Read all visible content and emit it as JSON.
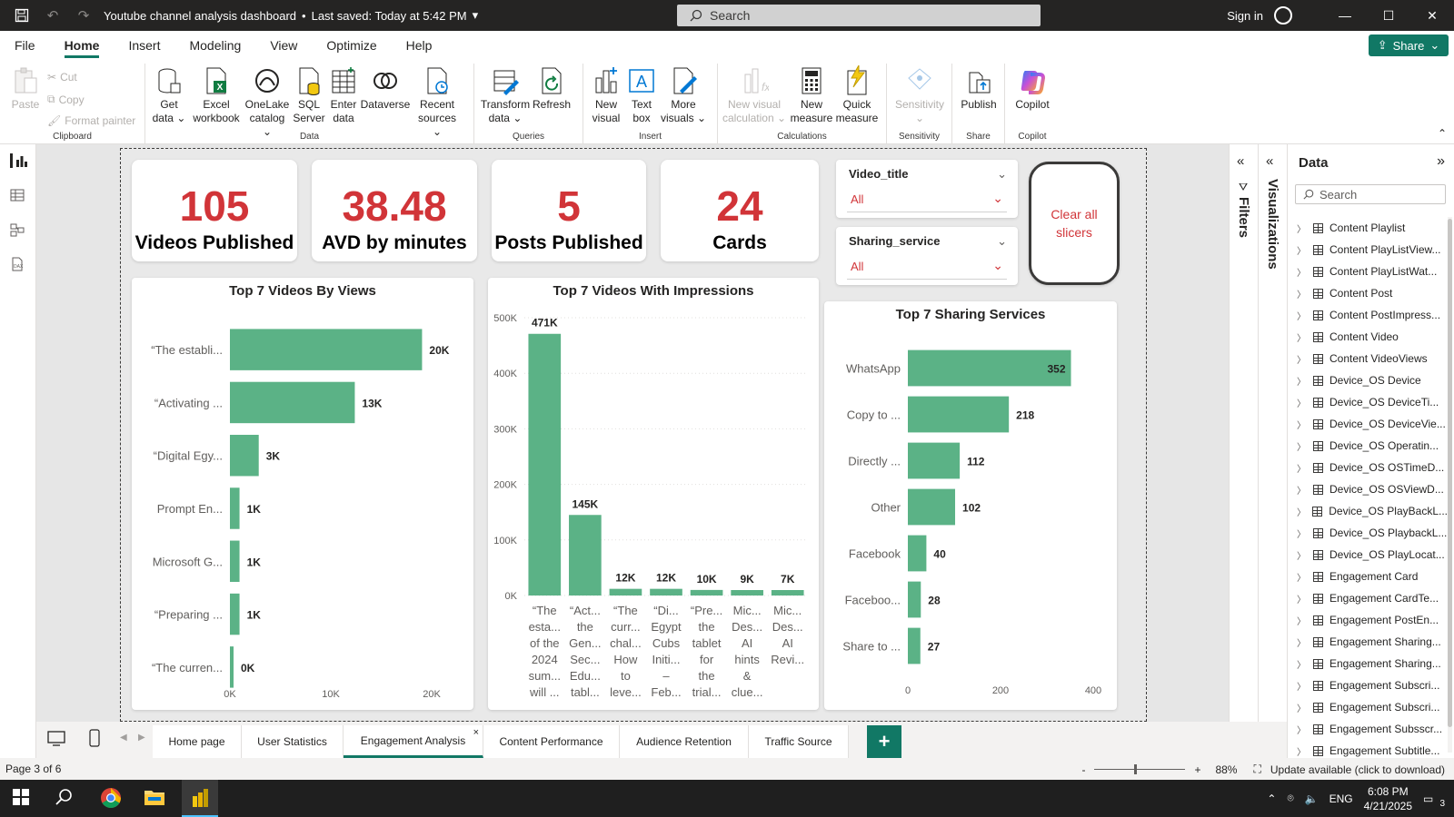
{
  "window": {
    "title": "Youtube channel analysis dashboard",
    "saved": "Last saved: Today at 5:42 PM",
    "search_placeholder": "Search",
    "sign_in": "Sign in"
  },
  "menu": {
    "items": [
      "File",
      "Home",
      "Insert",
      "Modeling",
      "View",
      "Optimize",
      "Help"
    ],
    "active": "Home",
    "share_label": "Share"
  },
  "ribbon": {
    "clipboard": {
      "label": "Clipboard",
      "paste": "Paste",
      "cut": "Cut",
      "copy": "Copy",
      "format_painter": "Format painter"
    },
    "data": {
      "label": "Data",
      "get_data": "Get data",
      "excel": "Excel workbook",
      "onelake": "OneLake catalog",
      "sql": "SQL Server",
      "enter": "Enter data",
      "dataverse": "Dataverse",
      "recent": "Recent sources"
    },
    "queries": {
      "label": "Queries",
      "transform": "Transform data",
      "refresh": "Refresh"
    },
    "insert": {
      "label": "Insert",
      "new_visual": "New visual",
      "text_box": "Text box",
      "more_visuals": "More visuals"
    },
    "calculations": {
      "label": "Calculations",
      "new_visual_calc": "New visual calculation",
      "new_measure": "New measure",
      "quick_measure": "Quick measure"
    },
    "sensitivity": {
      "label": "Sensitivity",
      "btn": "Sensitivity"
    },
    "share": {
      "label": "Share",
      "publish": "Publish"
    },
    "copilot": {
      "label": "Copilot",
      "btn": "Copilot"
    }
  },
  "kpis": [
    {
      "value": "105",
      "label": "Videos Published"
    },
    {
      "value": "38.48",
      "label": "AVD by minutes"
    },
    {
      "value": "5",
      "label": "Posts Published"
    },
    {
      "value": "24",
      "label": "Cards"
    }
  ],
  "slicers": [
    {
      "title": "Video_title",
      "value": "All"
    },
    {
      "title": "Sharing_service",
      "value": "All"
    }
  ],
  "clear_button": "Clear all slicers",
  "chart_data": [
    {
      "type": "bar",
      "orientation": "horizontal",
      "title": "Top 7 Videos By Views",
      "categories": [
        "“The establi...",
        "“Activating ...",
        "“Digital Egy...",
        "Prompt En...",
        "Microsoft G...",
        "“Preparing ...",
        "“The curren..."
      ],
      "values": [
        20,
        13,
        3,
        1,
        1,
        1,
        0
      ],
      "data_labels": [
        "20K",
        "13K",
        "3K",
        "1K",
        "1K",
        "1K",
        "0K"
      ],
      "xticks": [
        "0K",
        "10K",
        "20K"
      ],
      "xlim": [
        0,
        21
      ],
      "color": "#5bb286"
    },
    {
      "type": "bar",
      "orientation": "vertical",
      "title": "Top 7 Videos With Impressions",
      "categories": [
        [
          "“The",
          "esta...",
          "of the",
          "2024",
          "sum...",
          "will ..."
        ],
        [
          "“Act...",
          "the",
          "Gen...",
          "Sec...",
          "Edu...",
          "tabl..."
        ],
        [
          "“The",
          "curr...",
          "chal...",
          "How",
          "to",
          "leve..."
        ],
        [
          "“Di...",
          "Egypt",
          "Cubs",
          "Initi...",
          "–",
          "Feb..."
        ],
        [
          "“Pre...",
          "the",
          "tablet",
          "for",
          "the",
          "trial..."
        ],
        [
          "Mic...",
          "Des...",
          "AI",
          "hints",
          "&",
          "clue..."
        ],
        [
          "Mic...",
          "Des...",
          "AI",
          "Revi..."
        ]
      ],
      "values": [
        471,
        145,
        12,
        12,
        10,
        9,
        7
      ],
      "data_labels": [
        "471K",
        "145K",
        "12K",
        "12K",
        "10K",
        "9K",
        "7K"
      ],
      "yticks": [
        "0K",
        "100K",
        "200K",
        "300K",
        "400K",
        "500K"
      ],
      "ylim": [
        0,
        500
      ],
      "color": "#5bb286"
    },
    {
      "type": "bar",
      "orientation": "horizontal",
      "title": "Top 7 Sharing Services",
      "categories": [
        "WhatsApp",
        "Copy to ...",
        "Directly ...",
        "Other",
        "Facebook",
        "Faceboo...",
        "Share to ..."
      ],
      "values": [
        352,
        218,
        112,
        102,
        40,
        28,
        27
      ],
      "data_labels": [
        "352",
        "218",
        "112",
        "102",
        "40",
        "28",
        "27"
      ],
      "xticks": [
        "0",
        "200",
        "400"
      ],
      "xlim": [
        0,
        400
      ],
      "color": "#5bb286"
    }
  ],
  "panes": {
    "filters": "Filters",
    "visualizations": "Visualizations",
    "data_title": "Data",
    "data_search": "Search",
    "fields": [
      "Content Playlist",
      "Content PlayListView...",
      "Content PlayListWat...",
      "Content Post",
      "Content PostImpress...",
      "Content Video",
      "Content VideoViews",
      "Device_OS Device",
      "Device_OS DeviceTi...",
      "Device_OS DeviceVie...",
      "Device_OS Operatin...",
      "Device_OS OSTimeD...",
      "Device_OS OSViewD...",
      "Device_OS PlayBackL...",
      "Device_OS PlaybackL...",
      "Device_OS PlayLocat...",
      "Engagement Card",
      "Engagement CardTe...",
      "Engagement PostEn...",
      "Engagement Sharing...",
      "Engagement Sharing...",
      "Engagement Subscri...",
      "Engagement Subscri...",
      "Engagement Subsscr...",
      "Engagement Subtitle..."
    ]
  },
  "tabs": [
    "Home page",
    "User Statistics",
    "Engagement Analysis",
    "Content Performance",
    "Audience Retention",
    "Traffic Source"
  ],
  "active_tab": "Engagement Analysis",
  "status": {
    "page": "Page 3 of 6",
    "zoom": "88%",
    "update": "Update available (click to download)"
  },
  "taskbar": {
    "lang": "ENG",
    "time": "6:08 PM",
    "date": "4/21/2025",
    "notifications": "3"
  }
}
